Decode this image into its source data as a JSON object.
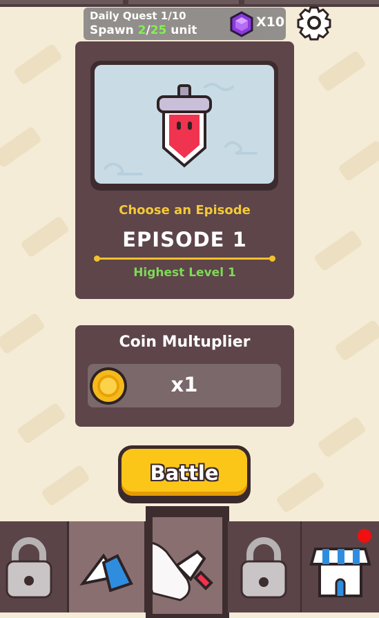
{
  "quest": {
    "title": "Daily Quest 1/10",
    "prefix": "Spawn ",
    "current": "2",
    "separator": "/",
    "goal": "25",
    "suffix": " unit"
  },
  "currency": {
    "gem_count": "X10",
    "gem_color": "#8b3ae0"
  },
  "episode": {
    "prompt": "Choose an Episode",
    "name": "EPISODE 1",
    "highest_level": "Highest Level 1"
  },
  "coin": {
    "title": "Coin Multuplier",
    "multiplier": "x1"
  },
  "battle_button": {
    "label": "Battle"
  },
  "nav": {
    "tabs": [
      {
        "icon": "lock-icon",
        "state": "locked"
      },
      {
        "icon": "unit-icon",
        "state": "normal"
      },
      {
        "icon": "sword-icon",
        "state": "selected"
      },
      {
        "icon": "lock-icon",
        "state": "locked"
      },
      {
        "icon": "shop-icon",
        "state": "normal",
        "notification": true
      }
    ]
  },
  "colors": {
    "accent_yellow": "#fcc619",
    "green": "#7ed957",
    "panel": "#5d4549",
    "notification": "#f20f0f"
  }
}
